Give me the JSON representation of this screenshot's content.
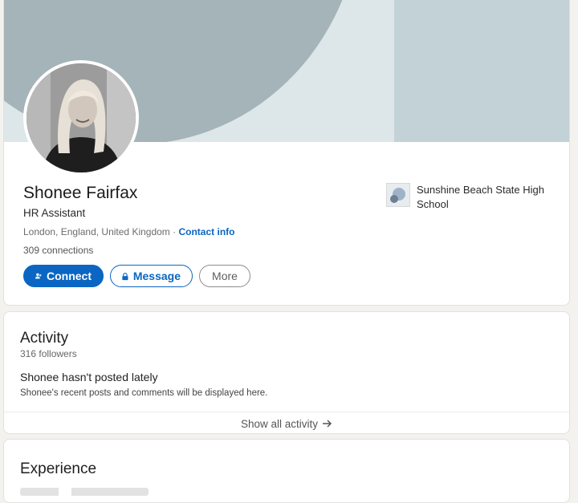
{
  "profile": {
    "name": "Shonee Fairfax",
    "headline": "HR Assistant",
    "location": "London, England, United Kingdom",
    "separator": " · ",
    "contact_info": "Contact info",
    "connections": "309 connections",
    "actions": {
      "connect": "Connect",
      "message": "Message",
      "more": "More"
    },
    "education": {
      "school": "Sunshine Beach State High School"
    },
    "colors": {
      "accent": "#0a66c2",
      "banner_dark": "#a5b4b8",
      "banner_light": "#dde7ea"
    }
  },
  "activity": {
    "title": "Activity",
    "followers": "316 followers",
    "empty_heading": "Shonee hasn't posted lately",
    "empty_sub": "Shonee's recent posts and comments will be displayed here.",
    "show_all": "Show all activity",
    "show_all_icon": "arrow-right-icon"
  },
  "experience": {
    "title": "Experience"
  }
}
